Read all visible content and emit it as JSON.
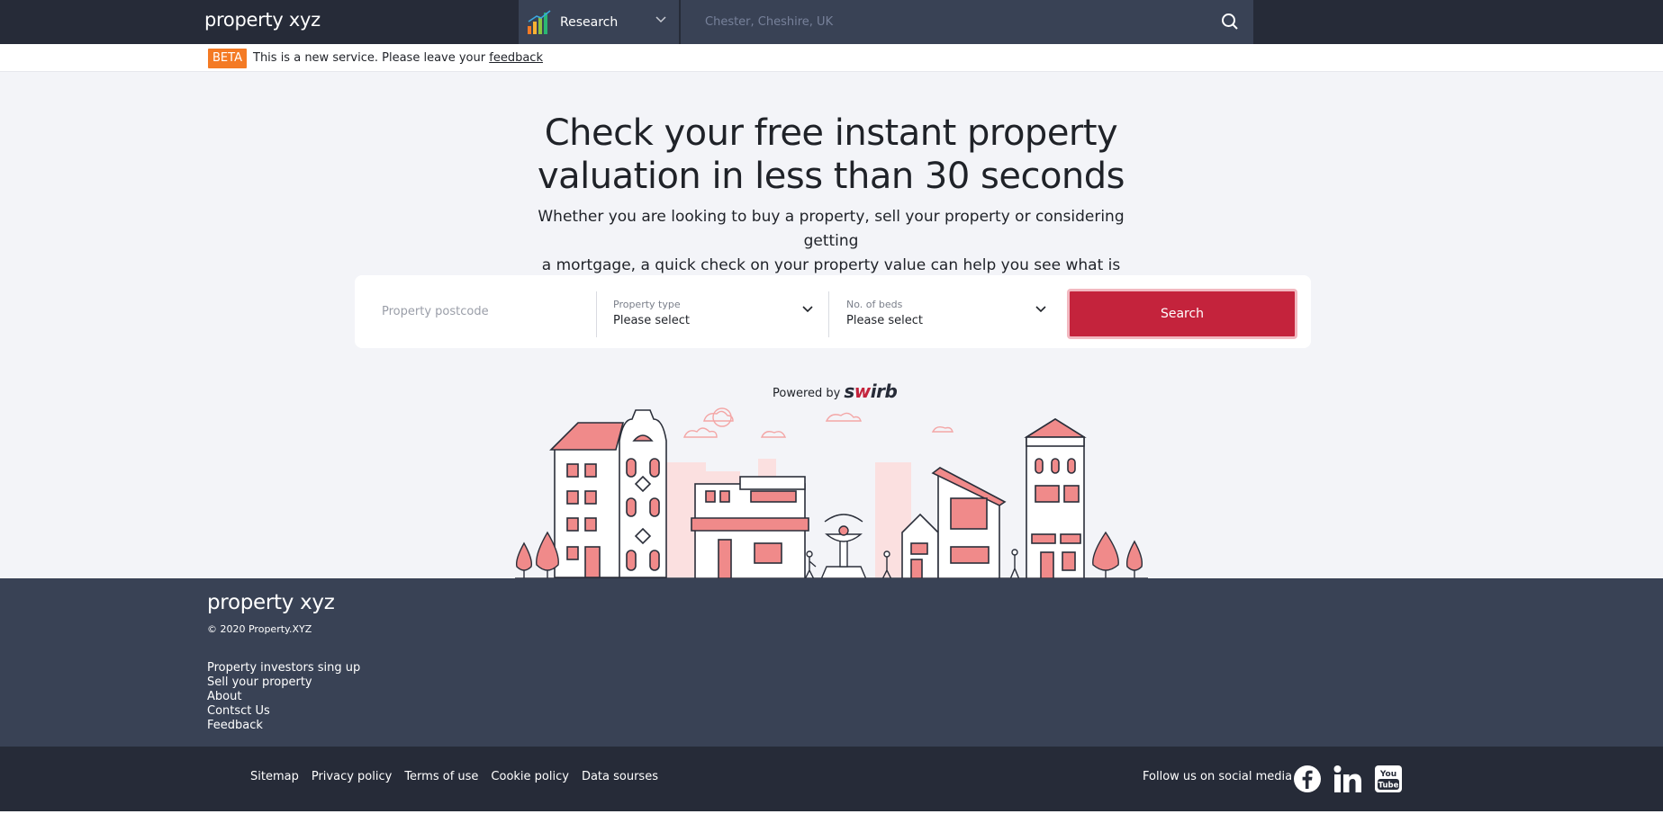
{
  "nav": {
    "logo": "property xyz",
    "research_label": "Research",
    "search_placeholder": "Chester, Cheshire, UK"
  },
  "beta": {
    "badge": "BETA",
    "text": "This is a new service. Please leave your",
    "link": "feedback"
  },
  "hero": {
    "title_line1": "Check your free instant property",
    "title_line2": "valuation in less than 30 seconds",
    "subtitle_line1": "Whether you are looking to buy a property, sell your property or considering getting",
    "subtitle_line2": "a mortgage, a quick check on your property value can help you see what is possible"
  },
  "form": {
    "postcode_placeholder": "Property postcode",
    "property_type_label": "Property type",
    "property_type_value": "Please select",
    "beds_label": "No. of beds",
    "beds_value": "Please select",
    "search_button": "Search"
  },
  "powered": {
    "prefix": "Powered by",
    "brand_a": "s",
    "brand_b": "w",
    "brand_c": "irb"
  },
  "footer": {
    "logo": "property xyz",
    "copyright": "© 2020 Property.XYZ",
    "links": [
      "Property investors sing up",
      "Sell your property",
      "About",
      "Contsct Us",
      "Feedback"
    ]
  },
  "bottom": {
    "links": [
      "Sitemap",
      "Privacy policy",
      "Terms of use",
      "Cookie policy",
      "Data sourses"
    ],
    "follow": "Follow us on social media"
  },
  "social_icons": [
    "facebook-icon",
    "linkedin-icon",
    "youtube-icon"
  ],
  "colors": {
    "nav_dark": "#262b38",
    "nav_panel": "#394255",
    "accent_red": "#c4233c",
    "beta_orange": "#f47a24",
    "hero_bg": "#f3f4f8"
  }
}
